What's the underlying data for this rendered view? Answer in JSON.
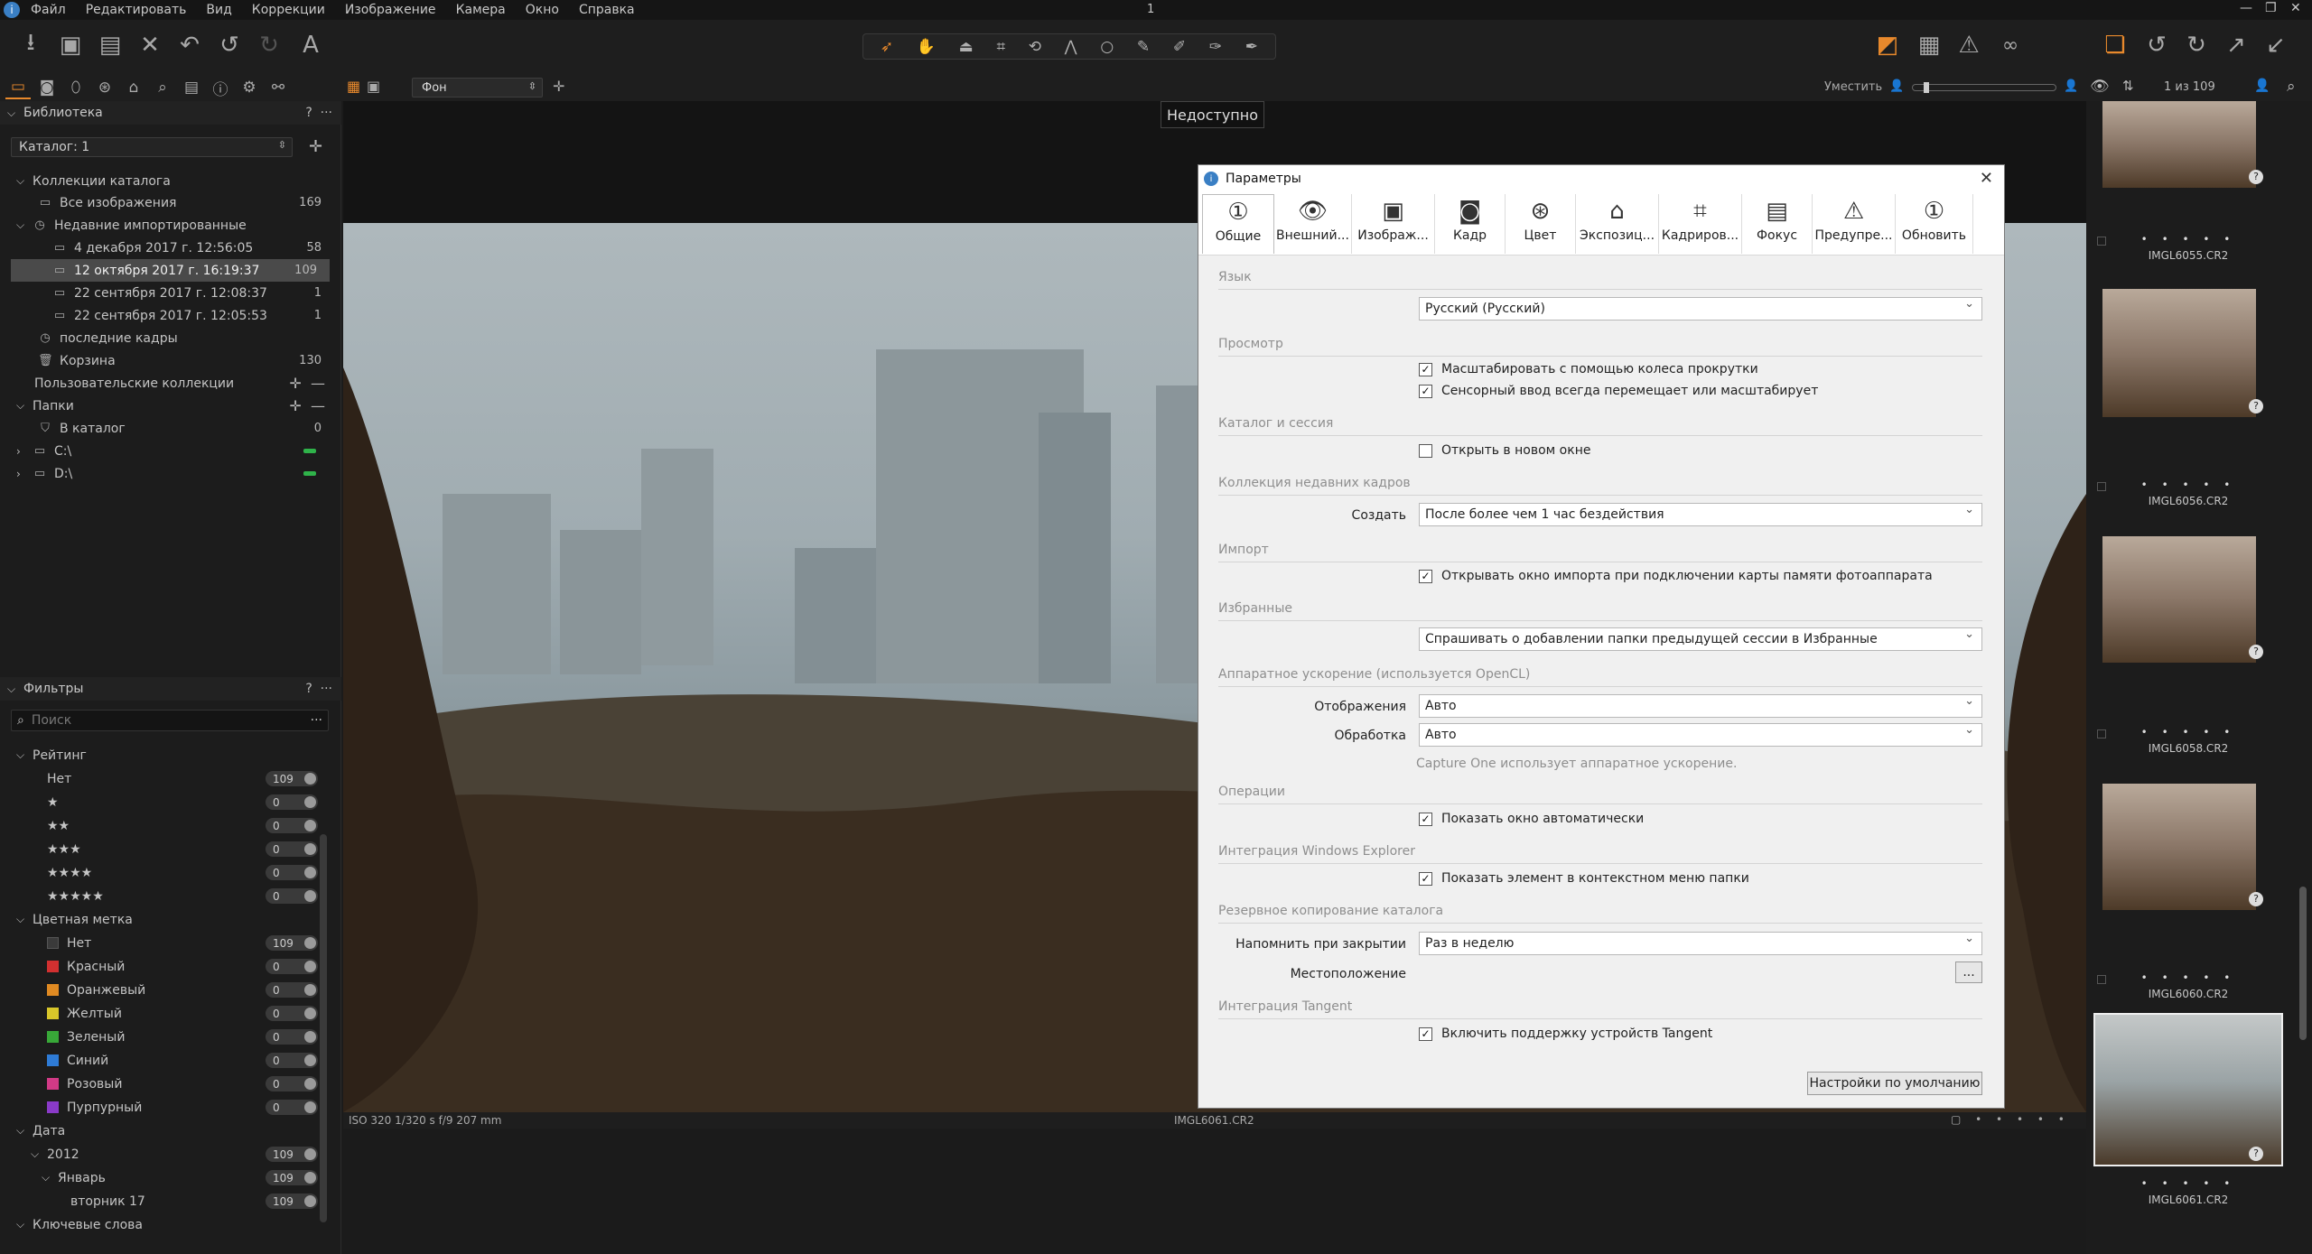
{
  "menubar": {
    "items": [
      "Файл",
      "Редактировать",
      "Вид",
      "Коррекции",
      "Изображение",
      "Камера",
      "Окно",
      "Справка"
    ],
    "title": "1"
  },
  "viewer": {
    "preset": "Фон",
    "fit_label": "Уместить",
    "unavailable": "Недоступно",
    "count": "1 из 109",
    "status_left": "ISO 320  1/320 s  f/9  207 mm",
    "status_center": "IMGL6061.CR2"
  },
  "library": {
    "title": "Библиотека",
    "catalog": "Каталог: 1",
    "collections_title": "Коллекции каталога",
    "all_images": "Все изображения",
    "all_images_count": "169",
    "recent_imports": "Недавние импортированные",
    "imports": [
      {
        "label": "4 декабря 2017 г. 12:56:05",
        "count": "58"
      },
      {
        "label": "12 октября 2017 г. 16:19:37",
        "count": "109"
      },
      {
        "label": "22 сентября 2017 г. 12:08:37",
        "count": "1"
      },
      {
        "label": "22 сентября 2017 г. 12:05:53",
        "count": "1"
      }
    ],
    "recent_shots": "последние кадры",
    "trash": "Корзина",
    "trash_count": "130",
    "user_collections": "Пользовательские коллекции",
    "folders": "Папки",
    "in_catalog": "В каталог",
    "in_catalog_count": "0",
    "drive_c": "C:\\",
    "drive_d": "D:\\"
  },
  "filters": {
    "title": "Фильтры",
    "search_placeholder": "Поиск",
    "rating_title": "Рейтинг",
    "rating": [
      {
        "label": "Нет",
        "count": "109"
      },
      {
        "label": "★",
        "count": "0"
      },
      {
        "label": "★★",
        "count": "0"
      },
      {
        "label": "★★★",
        "count": "0"
      },
      {
        "label": "★★★★",
        "count": "0"
      },
      {
        "label": "★★★★★",
        "count": "0"
      }
    ],
    "color_title": "Цветная метка",
    "colors": [
      {
        "label": "Нет",
        "count": "109",
        "hex": "#3a3a3a"
      },
      {
        "label": "Красный",
        "count": "0",
        "hex": "#d23030"
      },
      {
        "label": "Оранжевый",
        "count": "0",
        "hex": "#e08a22"
      },
      {
        "label": "Желтый",
        "count": "0",
        "hex": "#d8c62a"
      },
      {
        "label": "Зеленый",
        "count": "0",
        "hex": "#38a838"
      },
      {
        "label": "Синий",
        "count": "0",
        "hex": "#2e7bd6"
      },
      {
        "label": "Розовый",
        "count": "0",
        "hex": "#d23a86"
      },
      {
        "label": "Пурпурный",
        "count": "0",
        "hex": "#8a3ac8"
      }
    ],
    "date_title": "Дата",
    "year": "2012",
    "year_count": "109",
    "month": "Январь",
    "month_count": "109",
    "day": "вторник 17",
    "day_count": "109",
    "keywords": "Ключевые слова"
  },
  "dialog": {
    "title": "Параметры",
    "tabs": [
      "Общие",
      "Внешний...",
      "Изображ...",
      "Кадр",
      "Цвет",
      "Экспозиц...",
      "Кадриров...",
      "Фокус",
      "Предупре...",
      "Обновить"
    ],
    "sec_language": "Язык",
    "language": "Русский (Русский)",
    "sec_view": "Просмотр",
    "chk_scroll": "Масштабировать с помощью колеса прокрутки",
    "chk_touch": "Сенсорный ввод всегда перемещает или масштабирует",
    "sec_catalog": "Каталог и сессия",
    "chk_newwin": "Открыть в новом окне",
    "sec_recent": "Коллекция недавних кадров",
    "create_label": "Создать",
    "create_value": "После более чем 1 час бездействия",
    "sec_import": "Импорт",
    "chk_import": "Открывать окно импорта при подключении карты памяти фотоаппарата",
    "sec_favorites": "Избранные",
    "favorites_value": "Спрашивать о добавлении папки предыдущей сессии в Избранные",
    "sec_hw": "Аппаратное ускорение (используется OpenCL)",
    "display_label": "Отображения",
    "display_value": "Авто",
    "process_label": "Обработка",
    "process_value": "Авто",
    "hw_note": "Capture One использует аппаратное ускорение.",
    "sec_operations": "Операции",
    "chk_ops": "Показать окно автоматически",
    "sec_explorer": "Интеграция Windows Explorer",
    "chk_explorer": "Показать элемент в контекстном меню папки",
    "sec_backup": "Резервное копирование каталога",
    "remind_label": "Напомнить при закрытии",
    "remind_value": "Раз в неделю",
    "location_label": "Местоположение",
    "browse": "...",
    "sec_tangent": "Интеграция Tangent",
    "chk_tangent": "Включить поддержку устройств Tangent",
    "defaults_button": "Настройки по умолчанию"
  },
  "filmstrip": [
    {
      "name": ""
    },
    {
      "name": "IMGL6055.CR2"
    },
    {
      "name": "IMGL6056.CR2"
    },
    {
      "name": "IMGL6058.CR2"
    },
    {
      "name": "IMGL6060.CR2"
    },
    {
      "name": "IMGL6061.CR2"
    }
  ],
  "accent": "#e8892c"
}
